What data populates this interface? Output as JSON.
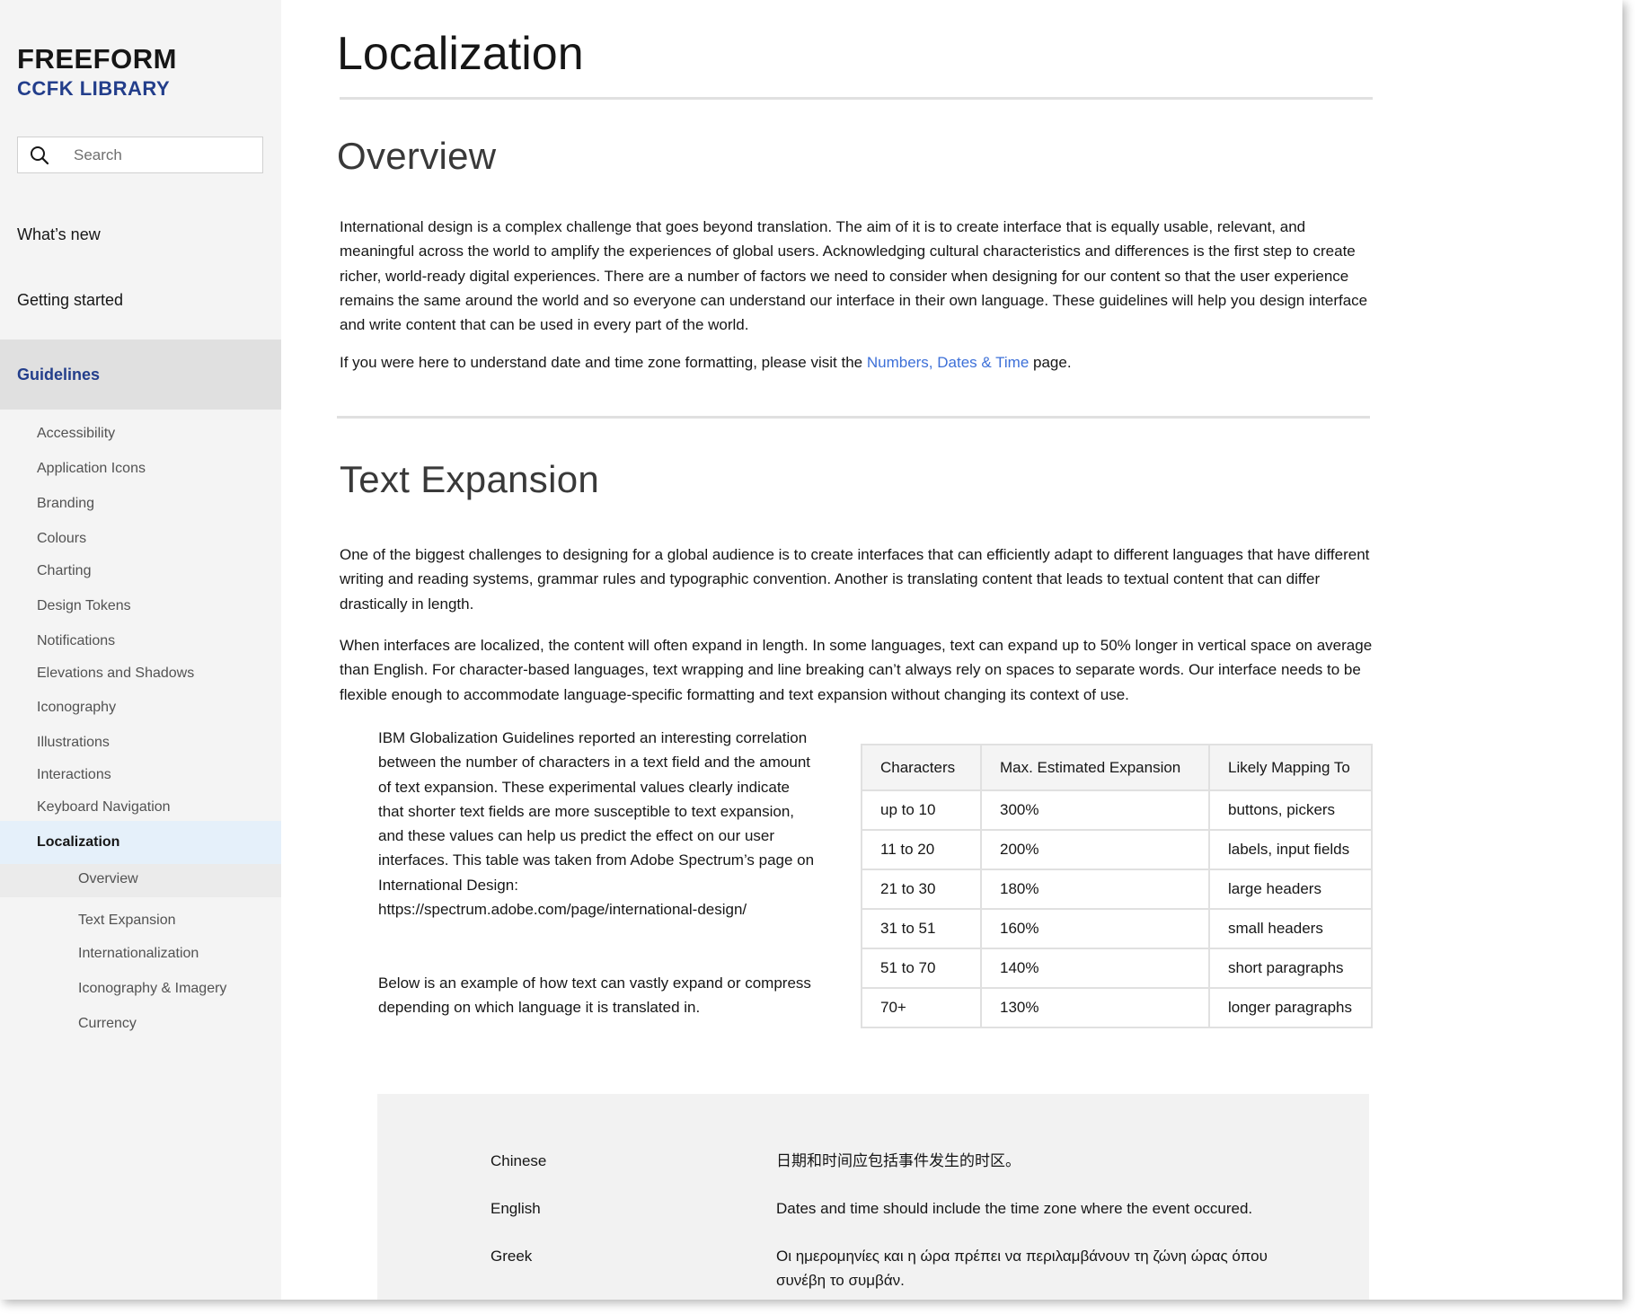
{
  "sidebar": {
    "brand_title": "FREEFORM",
    "brand_subtitle": "CCFK LIBRARY",
    "search_placeholder": "Search",
    "top_items": [
      "What’s new",
      "Getting started"
    ],
    "section_label": "Guidelines",
    "guideline_items": [
      "Accessibility",
      "Application Icons",
      "Branding",
      "Colours",
      "Charting",
      "Design Tokens",
      "Notifications",
      "Elevations and Shadows",
      "Iconography",
      "Illustrations",
      "Interactions",
      "Keyboard Navigation"
    ],
    "active_item": "Localization",
    "active_subitems": [
      "Overview",
      "Text Expansion",
      "Internationalization",
      "Iconography & Imagery",
      "Currency"
    ]
  },
  "main": {
    "title": "Localization",
    "overview_heading": "Overview",
    "overview_para": "International design is a complex challenge that goes beyond translation. The aim of it is to create interface that is equally usable, relevant, and meaningful across the world to amplify the experiences of global users. Acknowledging cultural characteristics and differences is the first step to create richer, world-ready digital experiences. There are a number of factors we need to consider when designing for our content so that the user experience remains the same around the world and so everyone can understand our interface in their own language. These guidelines will help you design interface and write content that can be used in every part of the world.",
    "visit_prefix": "If you were here to understand date and time zone formatting, please visit the ",
    "visit_link": "Numbers, Dates & Time",
    "visit_suffix": " page.",
    "text_expansion_heading": "Text Expansion",
    "te_para1": "One of the biggest challenges to designing for a global audience is to create interfaces that can efficiently adapt to different languages that have different writing and reading systems, grammar rules and typographic convention. Another is translating content that leads to textual content that can differ drastically in length.",
    "te_para2": "When interfaces are localized, the content will often expand in length. In some languages, text can expand up to 50% longer in vertical space on average than English. For character-based languages, text wrapping and line breaking can’t always rely on spaces to separate words. Our interface needs to be flexible enough to accommodate language-specific formatting and text expansion without changing its context of use.",
    "aside_para1": "IBM Globalization Guidelines reported an interesting correlation between the number of characters in a text field and the amount of text expansion. These experimental values clearly indicate that shorter text fields are more susceptible to text expansion, and these values can help us predict the effect on our user interfaces. This table was taken from Adobe Spectrum’s page on International Design: https://spectrum.adobe.com/page/international-design/",
    "aside_para2": "Below is an example of how text can vastly expand or compress depending on which language it is translated in.",
    "table": {
      "headers": [
        "Characters",
        "Max. Estimated Expansion",
        "Likely Mapping To"
      ],
      "rows": [
        [
          "up to 10",
          "300%",
          "buttons, pickers"
        ],
        [
          "11 to 20",
          "200%",
          "labels, input fields"
        ],
        [
          "21 to 30",
          "180%",
          "large headers"
        ],
        [
          "31 to 51",
          "160%",
          "small headers"
        ],
        [
          "51 to 70",
          "140%",
          "short paragraphs"
        ],
        [
          "70+",
          "130%",
          "longer paragraphs"
        ]
      ]
    },
    "languages": [
      {
        "name": "Chinese",
        "text": "日期和时间应包括事件发生的时区。"
      },
      {
        "name": "English",
        "text": "Dates and time should include the time zone where the event occured."
      },
      {
        "name": "Greek",
        "text": "Οι ημερομηνίες και η ώρα πρέπει να περιλαμβάνουν τη ζώνη ώρας όπου συνέβη το συμβάν."
      }
    ]
  },
  "colors": {
    "brand_blue": "#233e8b",
    "link": "#3d70d8",
    "sidebar_bg": "#f4f4f4",
    "active_bg": "#e5f0fa"
  },
  "icons": {
    "search": "search-icon"
  }
}
